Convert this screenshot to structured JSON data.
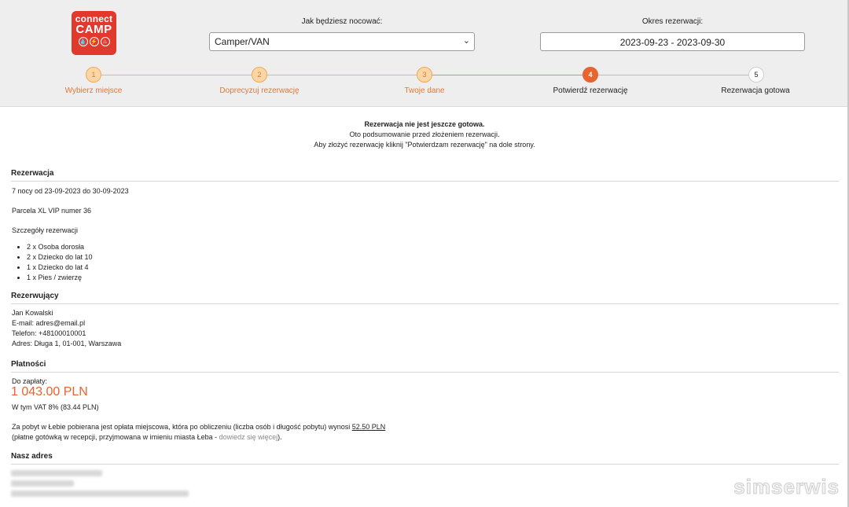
{
  "logo": {
    "line1": "connect",
    "line2": "CAMP",
    "icon1": "💧",
    "icon2": "⚡",
    "icon3": "♨"
  },
  "search": {
    "stay_label": "Jak będziesz nocować:",
    "stay_value": "Camper/VAN",
    "period_label": "Okres rezerwacji:",
    "period_value": "2023-09-23 - 2023-09-30"
  },
  "steps": [
    {
      "num": "1",
      "label": "Wybierz miejsce",
      "state": "done"
    },
    {
      "num": "2",
      "label": "Doprecyzuj rezerwację",
      "state": "done"
    },
    {
      "num": "3",
      "label": "Twoje dane",
      "state": "done"
    },
    {
      "num": "4",
      "label": "Potwierdź rezerwację",
      "state": "active"
    },
    {
      "num": "5",
      "label": "Rezerwacja gotowa",
      "state": "todo"
    }
  ],
  "notice": {
    "line1": "Rezerwacja nie jest jeszcze gotowa.",
    "line2": "Oto podsumowanie przed złożeniem rezerwacji.",
    "line3": "Aby złożyć rezerwację kliknij \"Potwierdzam rezerwację\" na dole strony."
  },
  "reservation": {
    "title": "Rezerwacja",
    "nights": "7 nocy od 23-09-2023 do 30-09-2023",
    "pitch": "Parcela XL VIP numer 36",
    "details_label": "Szczegóły rezerwacji",
    "items": [
      "2 x Osoba dorosła",
      "2 x Dziecko do lat 10",
      "1 x Dziecko do lat 4",
      "1 x Pies / zwierzę"
    ]
  },
  "booker": {
    "title": "Rezerwujący",
    "name": "Jan  Kowalski",
    "email": "E-mail: adres@email.pl",
    "phone": "Telefon: +48100010001",
    "address": "Adres: Długa 1, 01-001, Warszawa"
  },
  "payments": {
    "title": "Płatności",
    "due_label": "Do zapłaty:",
    "amount": "1 043.00 PLN",
    "vat": "W tym VAT 8% (83.44 PLN)",
    "tax_text": "Za pobyt w Łebie pobierana jest opłata miejscowa, która po obliczeniu (liczba osób i długość pobytu) wynosi ",
    "tax_amount": "52.50 PLN",
    "tax_note": "(płatne gotówką w recepcji, przyjmowana w imieniu miasta Łeba - ",
    "tax_link": "dowiedz się więcej",
    "tax_note_end": ")."
  },
  "address": {
    "title": "Nasz adres"
  },
  "watermark": "simserwis"
}
